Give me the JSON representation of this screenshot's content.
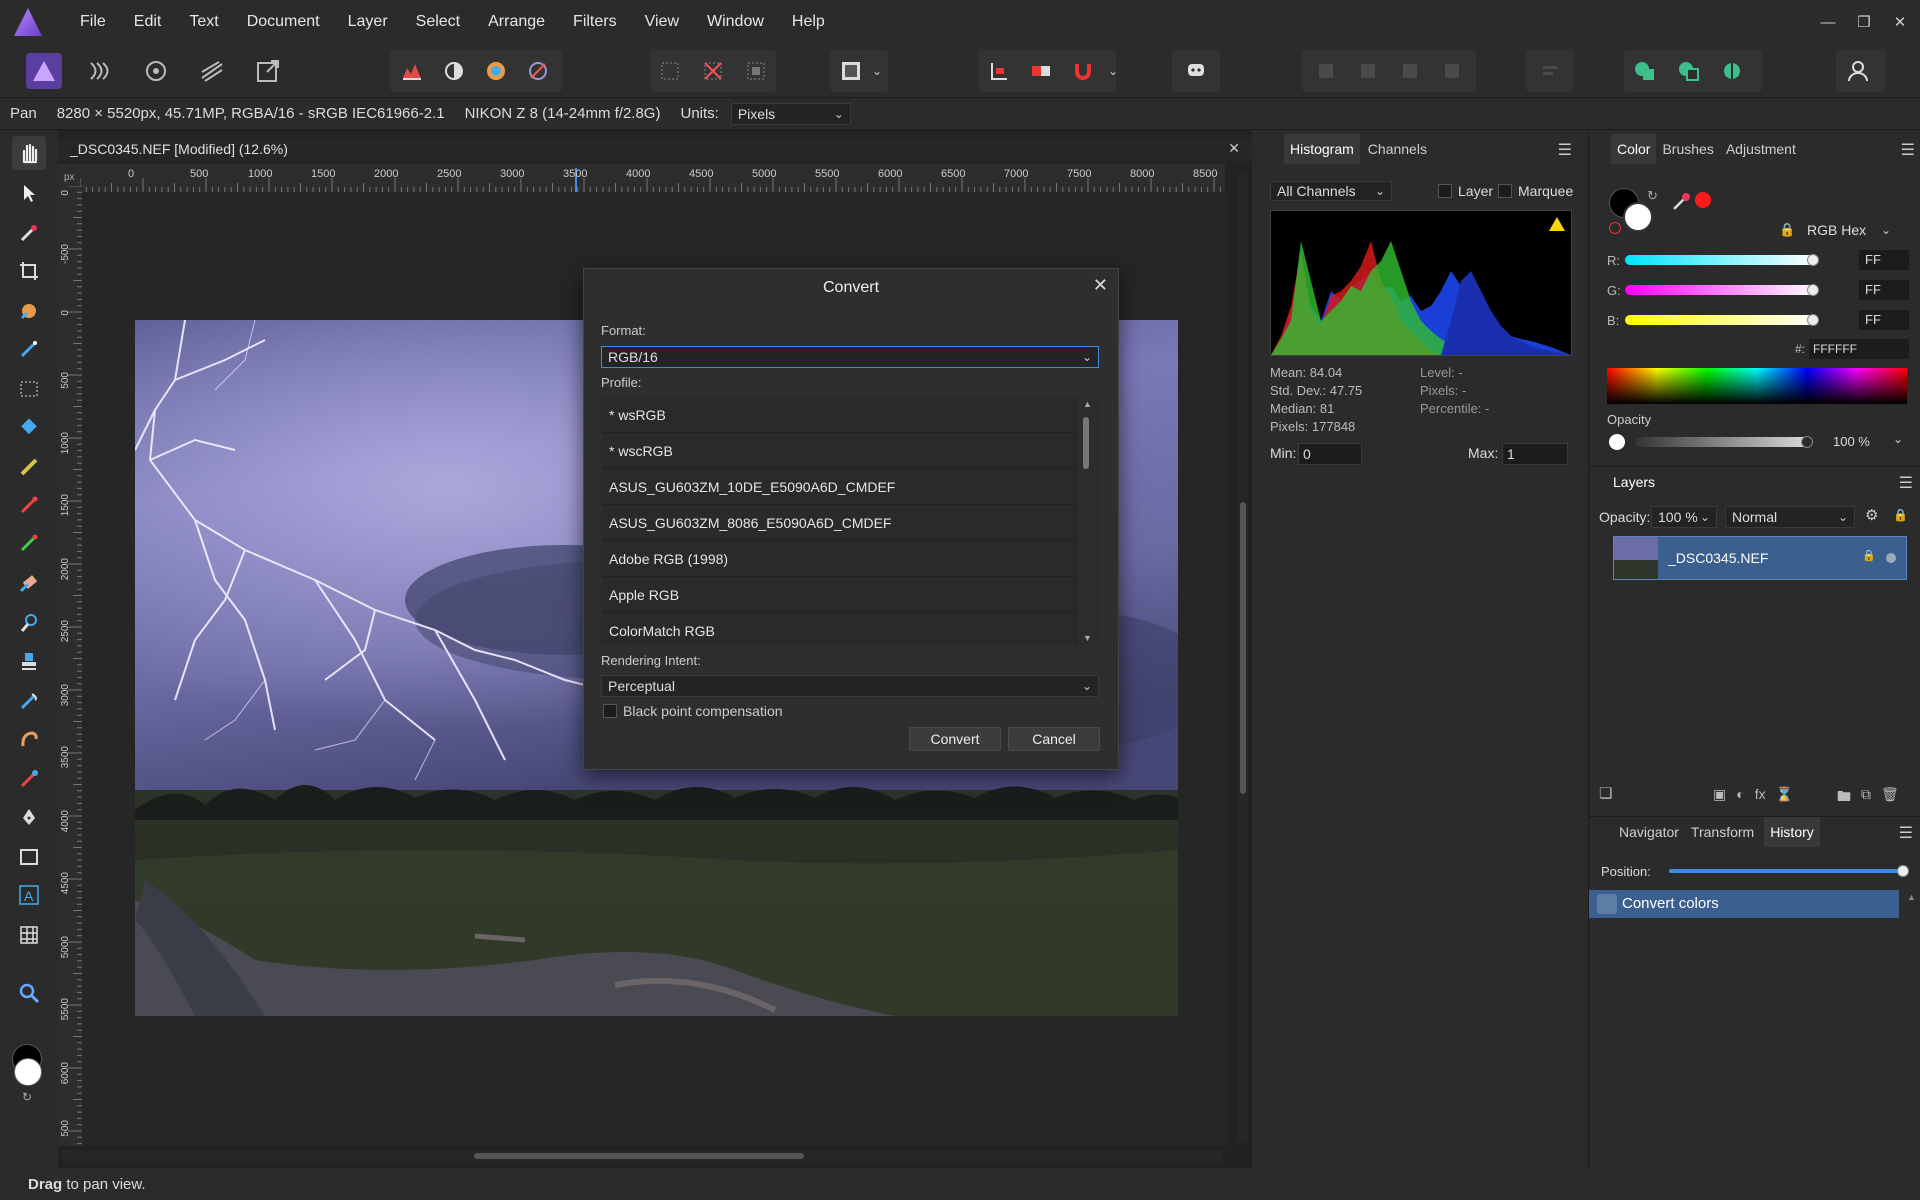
{
  "menu": {
    "items": [
      "File",
      "Edit",
      "Text",
      "Document",
      "Layer",
      "Select",
      "Arrange",
      "Filters",
      "View",
      "Window",
      "Help"
    ]
  },
  "context_bar": {
    "tool": "Pan",
    "doc_info": "8280 × 5520px, 45.71MP, RGBA/16 - sRGB IEC61966-2.1",
    "camera": "NIKON Z 8 (14-24mm f/2.8G)",
    "units_label": "Units:",
    "units_value": "Pixels"
  },
  "document": {
    "tab_title": "_DSC0345.NEF [Modified] (12.6%)",
    "ruler_unit": "px",
    "ruler_h": [
      "0",
      "500",
      "1000",
      "1500",
      "2000",
      "2500",
      "3000",
      "3500",
      "4000",
      "4500",
      "5000",
      "5500",
      "6000",
      "6500",
      "7000",
      "7500",
      "8000",
      "8500"
    ],
    "ruler_v": [
      "0",
      "-500",
      "0",
      "500",
      "1000",
      "1500",
      "2000",
      "2500",
      "3000",
      "3500",
      "4000",
      "4500",
      "5000",
      "5500",
      "6000",
      "500"
    ]
  },
  "dialog": {
    "title": "Convert",
    "format_label": "Format:",
    "format_value": "RGB/16",
    "profile_label": "Profile:",
    "profiles": [
      "* wsRGB",
      "* wscRGB",
      "ASUS_GU603ZM_10DE_E5090A6D_CMDEF",
      "ASUS_GU603ZM_8086_E5090A6D_CMDEF",
      "Adobe RGB (1998)",
      "Apple RGB",
      "ColorMatch RGB"
    ],
    "intent_label": "Rendering Intent:",
    "intent_value": "Perceptual",
    "bpc_label": "Black point compensation",
    "convert_label": "Convert",
    "cancel_label": "Cancel"
  },
  "histogram": {
    "tabs": [
      "Histogram",
      "Channels"
    ],
    "channel_select": "All Channels",
    "layer_label": "Layer",
    "marquee_label": "Marquee",
    "stats_left": [
      "Mean: 84.04",
      "Std. Dev.: 47.75",
      "Median: 81",
      "Pixels: 177848"
    ],
    "stats_right": [
      "Level: -",
      "Pixels: -",
      "Percentile: -"
    ],
    "min_label": "Min:",
    "min_value": "0",
    "max_label": "Max:",
    "max_value": "1"
  },
  "color": {
    "tabs": [
      "Color",
      "Brushes",
      "Adjustment"
    ],
    "mode": "RGB Hex",
    "channels": [
      {
        "label": "R:",
        "value": "FF"
      },
      {
        "label": "G:",
        "value": "FF"
      },
      {
        "label": "B:",
        "value": "FF"
      }
    ],
    "hex_label": "#:",
    "hex_value": "FFFFFF",
    "opacity_label": "Opacity",
    "opacity_value": "100 %",
    "colors": {
      "r": "#00e5ff",
      "g": "#ff00ff",
      "b": "#ffff00",
      "accent": "#ff1a1a"
    }
  },
  "layers": {
    "title": "Layers",
    "opacity_label": "Opacity:",
    "opacity_value": "100 %",
    "blend": "Normal",
    "layer_name": "_DSC0345.NEF"
  },
  "history": {
    "tabs": [
      "Navigator",
      "Transform",
      "History"
    ],
    "position_label": "Position:",
    "entries": [
      "Convert colors"
    ]
  },
  "status": {
    "bold": "Drag",
    "text": " to pan view."
  }
}
